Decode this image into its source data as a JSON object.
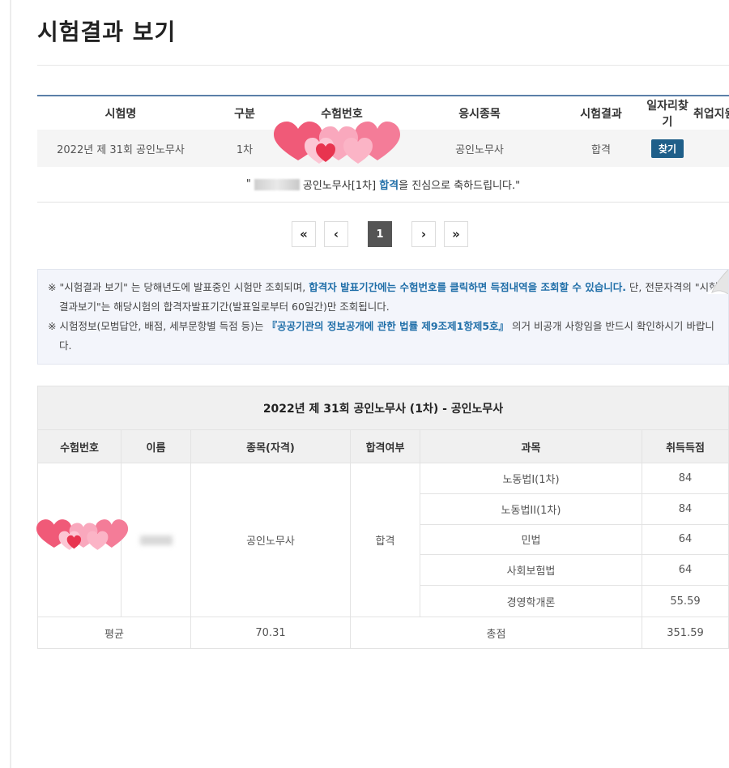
{
  "page": {
    "title": "시험결과 보기"
  },
  "result_list": {
    "headers": [
      "시험명",
      "구분",
      "수험번호",
      "응시종목",
      "시험결과",
      "일자리찾기",
      "취업지원"
    ],
    "row": {
      "exam_name": "2022년 제 31회 공인노무사",
      "division": "1차",
      "exam_number": "",
      "category": "공인노무사",
      "result": "합격",
      "find_button": "찾기"
    },
    "congrats": {
      "open_quote": "\"",
      "qualification": "공인노무사[1차]",
      "pass_word": "합격",
      "message": "을 진심으로 축하드립니다.\""
    }
  },
  "pagination": {
    "first": "«",
    "prev": "‹",
    "current": "1",
    "next": "›",
    "last": "»"
  },
  "notice": {
    "line1_a": "※ \"시험결과 보기\" 는 당해년도에 발표중인 시험만 조회되며, ",
    "line1_highlight": "합격자 발표기간에는 수험번호를 클릭하면 득점내역을 조회할 수 있습니다.",
    "line1_b": " 단, 전문자격의 \"시험결과보기\"는 해당시험의 합격자발표기간(발표일로부터 60일간)만 조회됩니다.",
    "line2_a": "※ 시험정보(모범답안, 배점, 세부문항별 득점 등)는 ",
    "line2_highlight": "『공공기관의 정보공개에 관한 법률 제9조제1항제5호』",
    "line2_b": " 의거 비공개 사항임을 반드시 확인하시기 바랍니다."
  },
  "detail": {
    "title": "2022년 제 31회 공인노무사 (1차) - 공인노무사",
    "headers": [
      "수험번호",
      "이름",
      "종목(자격)",
      "합격여부",
      "과목",
      "취득득점"
    ],
    "qualification": "공인노무사",
    "pass_status": "합격",
    "subjects": [
      {
        "name": "노동법I(1차)",
        "score": "84"
      },
      {
        "name": "노동법II(1차)",
        "score": "84"
      },
      {
        "name": "민법",
        "score": "64"
      },
      {
        "name": "사회보험법",
        "score": "64"
      },
      {
        "name": "경영학개론",
        "score": "55.59"
      }
    ],
    "average_label": "평균",
    "average_value": "70.31",
    "total_label": "총점",
    "total_value": "351.59"
  },
  "colors": {
    "accent": "#1f5f89",
    "highlight": "#1f6ea8",
    "heart_pink": "#f06a86"
  }
}
